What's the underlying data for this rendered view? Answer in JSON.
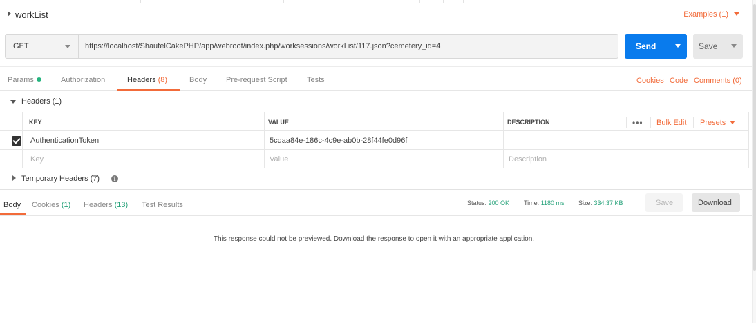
{
  "request": {
    "name": "workList",
    "examples_label": "Examples (1)",
    "method": "GET",
    "url": "https://localhost/ShaufelCakePHP/app/webroot/index.php/worksessions/workList/117.json?cemetery_id=4",
    "send_label": "Send",
    "save_label": "Save"
  },
  "request_tabs": {
    "params_label": "Params",
    "authorization_label": "Authorization",
    "headers_label": "Headers",
    "headers_count": "(8)",
    "body_label": "Body",
    "prerequest_label": "Pre-request Script",
    "tests_label": "Tests",
    "cookies_link": "Cookies",
    "code_link": "Code",
    "comments_link": "Comments (0)"
  },
  "headers_section": {
    "title": "Headers (1)",
    "columns": {
      "key": "KEY",
      "value": "VALUE",
      "description": "DESCRIPTION"
    },
    "more_icon": "•••",
    "bulk_edit_label": "Bulk Edit",
    "presets_label": "Presets",
    "rows": [
      {
        "checked": true,
        "key": "AuthenticationToken",
        "value": "5cdaa84e-186c-4c9e-ab0b-28f44fe0d96f",
        "description": ""
      }
    ],
    "placeholders": {
      "key": "Key",
      "value": "Value",
      "description": "Description"
    }
  },
  "temporary_headers": {
    "title": "Temporary Headers (7)",
    "info_icon": "i"
  },
  "response": {
    "tabs": {
      "body_label": "Body",
      "cookies_label": "Cookies",
      "cookies_count": "(1)",
      "headers_label": "Headers",
      "headers_count": "(13)",
      "test_results_label": "Test Results"
    },
    "status_label": "Status:",
    "status_value": "200 OK",
    "time_label": "Time:",
    "time_value": "1180 ms",
    "size_label": "Size:",
    "size_value": "334.37 KB",
    "save_label": "Save",
    "download_label": "Download",
    "message": "This response could not be previewed. Download the response to open it with an appropriate application."
  },
  "colors": {
    "accent": "#f26b3a",
    "send_button": "#097bed",
    "success": "#26a27a"
  }
}
